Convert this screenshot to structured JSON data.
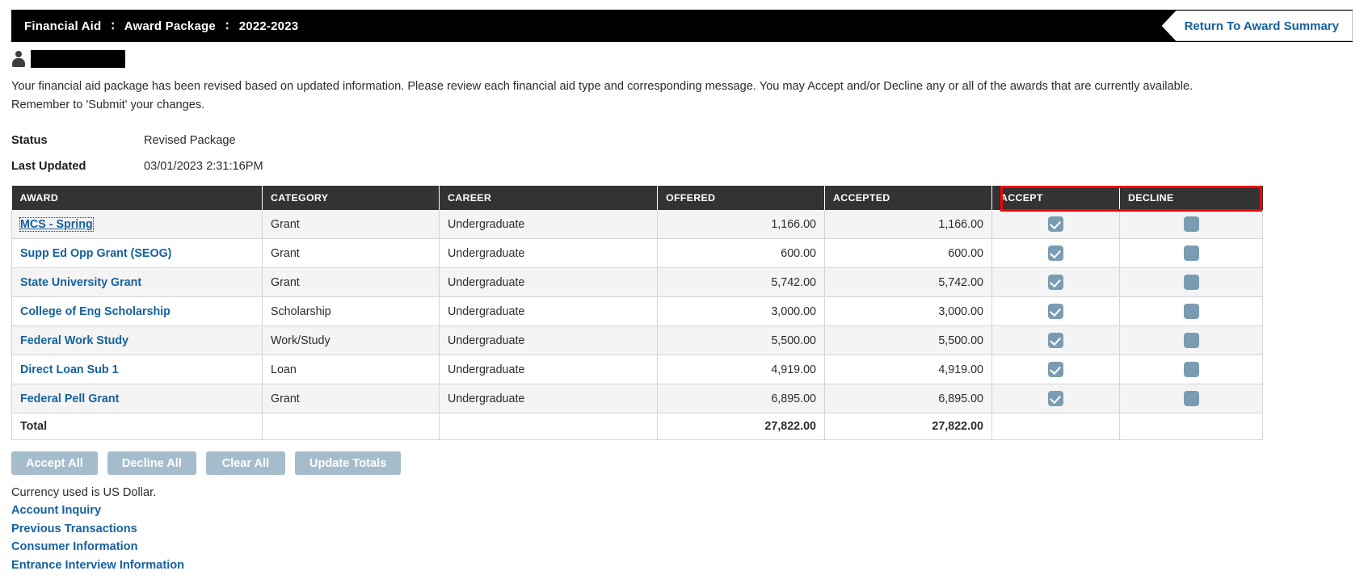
{
  "header": {
    "breadcrumb": [
      "Financial Aid",
      "Award Package",
      "2022-2023"
    ],
    "separator": "∶",
    "return_button": "Return To Award Summary"
  },
  "user": {
    "name_redacted": ""
  },
  "intro": {
    "text": "Your financial aid package has been revised based on updated information. Please review each financial aid type and corresponding message. You may Accept and/or Decline any or all of the awards that are currently available. Remember to 'Submit' your changes."
  },
  "status": {
    "status_label": "Status",
    "status_value": "Revised Package",
    "last_updated_label": "Last Updated",
    "last_updated_value": "03/01/2023  2:31:16PM"
  },
  "table": {
    "columns": [
      "AWARD",
      "CATEGORY",
      "CAREER",
      "OFFERED",
      "ACCEPTED",
      "ACCEPT",
      "DECLINE"
    ],
    "rows": [
      {
        "award": "MCS - Spring",
        "category": "Grant",
        "career": "Undergraduate",
        "offered": "1,166.00",
        "accepted": "1,166.00",
        "accept_checked": true,
        "decline_checked": false,
        "focused": true
      },
      {
        "award": "Supp Ed Opp Grant (SEOG)",
        "category": "Grant",
        "career": "Undergraduate",
        "offered": "600.00",
        "accepted": "600.00",
        "accept_checked": true,
        "decline_checked": false,
        "focused": false
      },
      {
        "award": "State University Grant",
        "category": "Grant",
        "career": "Undergraduate",
        "offered": "5,742.00",
        "accepted": "5,742.00",
        "accept_checked": true,
        "decline_checked": false,
        "focused": false
      },
      {
        "award": "College of Eng Scholarship",
        "category": "Scholarship",
        "career": "Undergraduate",
        "offered": "3,000.00",
        "accepted": "3,000.00",
        "accept_checked": true,
        "decline_checked": false,
        "focused": false
      },
      {
        "award": "Federal Work Study",
        "category": "Work/Study",
        "career": "Undergraduate",
        "offered": "5,500.00",
        "accepted": "5,500.00",
        "accept_checked": true,
        "decline_checked": false,
        "focused": false
      },
      {
        "award": "Direct Loan Sub 1",
        "category": "Loan",
        "career": "Undergraduate",
        "offered": "4,919.00",
        "accepted": "4,919.00",
        "accept_checked": true,
        "decline_checked": false,
        "focused": false
      },
      {
        "award": "Federal Pell Grant",
        "category": "Grant",
        "career": "Undergraduate",
        "offered": "6,895.00",
        "accepted": "6,895.00",
        "accept_checked": true,
        "decline_checked": false,
        "focused": false
      }
    ],
    "total_row": {
      "label": "Total",
      "category": "",
      "career": "",
      "offered": "27,822.00",
      "accepted": "27,822.00"
    }
  },
  "annotation": {
    "highlight_color": "#fc0000",
    "target": "ACCEPT and DECLINE columns"
  },
  "actions": {
    "accept_all": "Accept All",
    "decline_all": "Decline All",
    "clear_all": "Clear All",
    "update_totals": "Update Totals"
  },
  "footer": {
    "currency_note": "Currency used is US Dollar.",
    "links": [
      "Account Inquiry",
      "Previous Transactions",
      "Consumer Information",
      "Entrance Interview Information"
    ]
  },
  "colors": {
    "header_bar": "#000000",
    "table_header": "#333333",
    "link_blue": "#16619e",
    "button_blue": "#a5bccd",
    "checkbox_blue": "#7a9cb2"
  }
}
